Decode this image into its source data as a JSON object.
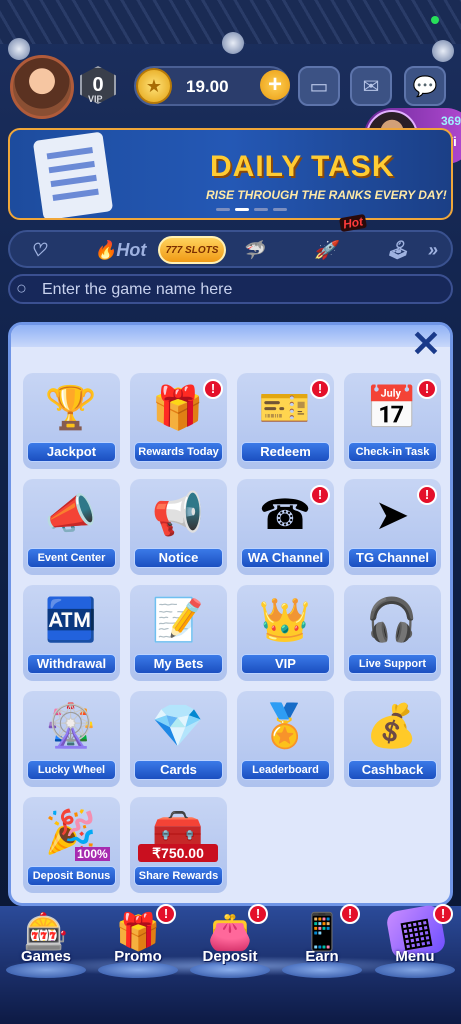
{
  "header": {
    "vip_level": "0",
    "vip_label": "VIP",
    "balance": "19.00",
    "plus_symbol": "+",
    "coin_symbol": "★"
  },
  "winner": {
    "amount": "369",
    "label": "Wi"
  },
  "banner": {
    "title": "DAILY TASK",
    "subtitle": "RISE THROUGH THE RANKS EVERY DAY!"
  },
  "tabs": {
    "hot": "Hot",
    "slots": "777 SLOTS",
    "hot_badge": "Hot"
  },
  "search": {
    "placeholder": "Enter the game name here"
  },
  "menu": {
    "close_symbol": "✕",
    "items": [
      {
        "label": "Jackpot",
        "icon": "trophy-icon",
        "glyph": "🏆",
        "badge": ""
      },
      {
        "label": "Rewards Today",
        "icon": "gift-box-icon",
        "glyph": "🎁",
        "badge": "!"
      },
      {
        "label": "Redeem",
        "icon": "ticket-icon",
        "glyph": "🎫",
        "badge": "!"
      },
      {
        "label": "Check-in Task",
        "icon": "calendar-check-icon",
        "glyph": "📅",
        "badge": "!"
      },
      {
        "label": "Event Center",
        "icon": "megaphone-icon",
        "glyph": "📣",
        "badge": ""
      },
      {
        "label": "Notice",
        "icon": "notice-megaphone-icon",
        "glyph": "📢",
        "badge": ""
      },
      {
        "label": "WA Channel",
        "icon": "whatsapp-icon",
        "glyph": "☎",
        "badge": "!"
      },
      {
        "label": "TG Channel",
        "icon": "telegram-icon",
        "glyph": "➤",
        "badge": "!"
      },
      {
        "label": "Withdrawal",
        "icon": "atm-icon",
        "glyph": "🏧",
        "badge": ""
      },
      {
        "label": "My Bets",
        "icon": "notepad-pen-icon",
        "glyph": "📝",
        "badge": ""
      },
      {
        "label": "VIP",
        "icon": "crown-throne-icon",
        "glyph": "👑",
        "badge": ""
      },
      {
        "label": "Live Support",
        "icon": "support-agent-icon",
        "glyph": "🎧",
        "badge": ""
      },
      {
        "label": "Lucky Wheel",
        "icon": "lucky-wheel-icon",
        "glyph": "🎡",
        "badge": ""
      },
      {
        "label": "Cards",
        "icon": "diamond-card-icon",
        "glyph": "💎",
        "badge": ""
      },
      {
        "label": "Leaderboard",
        "icon": "podium-crown-icon",
        "glyph": "🏅",
        "badge": ""
      },
      {
        "label": "Cashback",
        "icon": "cashback-icon",
        "glyph": "💰",
        "badge": ""
      },
      {
        "label": "Deposit Bonus",
        "icon": "bonus-box-icon",
        "glyph": "🎉",
        "badge": "",
        "extra": "100%"
      },
      {
        "label": "Share Rewards",
        "icon": "treasure-chest-icon",
        "glyph": "🧰",
        "badge": "",
        "amount": "₹750.00"
      }
    ]
  },
  "bottom_nav": [
    {
      "label": "Games",
      "icon": "slot-machine-icon",
      "glyph": "🎰",
      "badge": ""
    },
    {
      "label": "Promo",
      "icon": "gift-icon",
      "glyph": "🎁",
      "badge": "!"
    },
    {
      "label": "Deposit",
      "icon": "wallet-icon",
      "glyph": "👛",
      "badge": "!"
    },
    {
      "label": "Earn",
      "icon": "phone-coins-icon",
      "glyph": "📱",
      "badge": "!"
    },
    {
      "label": "Menu",
      "icon": "menu-cube-icon",
      "glyph": "▦",
      "badge": "!"
    }
  ]
}
